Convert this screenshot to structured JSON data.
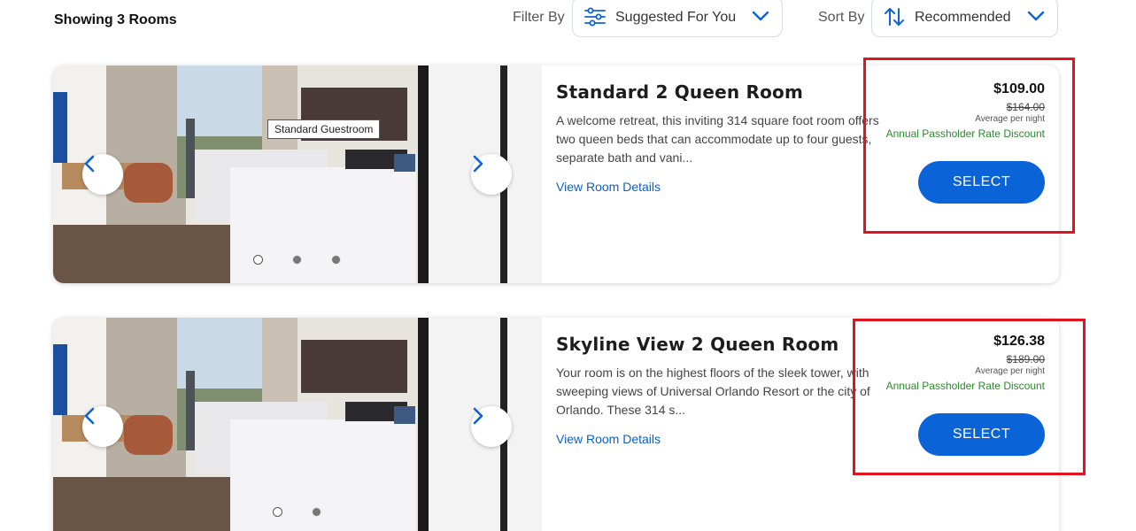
{
  "header": {
    "showing": "Showing 3 Rooms",
    "filter_label": "Filter By",
    "filter_value": "Suggested For You",
    "filter_icon": "sliders-icon",
    "sort_label": "Sort By",
    "sort_value": "Recommended",
    "sort_icon": "sort-arrows-icon"
  },
  "rooms": [
    {
      "title": "Standard 2 Queen Room",
      "description": "A welcome retreat, this inviting 314 square foot room offers two queen beds that can accommodate up to four guests, separate bath and vani...",
      "details_link": "View Room Details",
      "price": "$109.00",
      "old_price": "$164.00",
      "avg_label": "Average per night",
      "discount": "Annual Passholder Rate Discount",
      "select_label": "SELECT",
      "photo_tooltip": "Standard Guestroom",
      "carousel_total": 3,
      "carousel_active": 1
    },
    {
      "title": "Skyline View 2 Queen Room",
      "description": "Your room is on the highest floors of the sleek tower, with sweeping views of Universal Orlando Resort or the city of Orlando. These 314 s...",
      "details_link": "View Room Details",
      "price": "$126.38",
      "old_price": "$189.00",
      "avg_label": "Average per night",
      "discount": "Annual Passholder Rate Discount",
      "select_label": "SELECT",
      "carousel_total": 2,
      "carousel_active": 1
    }
  ],
  "colors": {
    "accent": "#0b63d8",
    "link": "#0a5fc7",
    "discount": "#2a8a2a",
    "highlight": "#e3121f"
  }
}
